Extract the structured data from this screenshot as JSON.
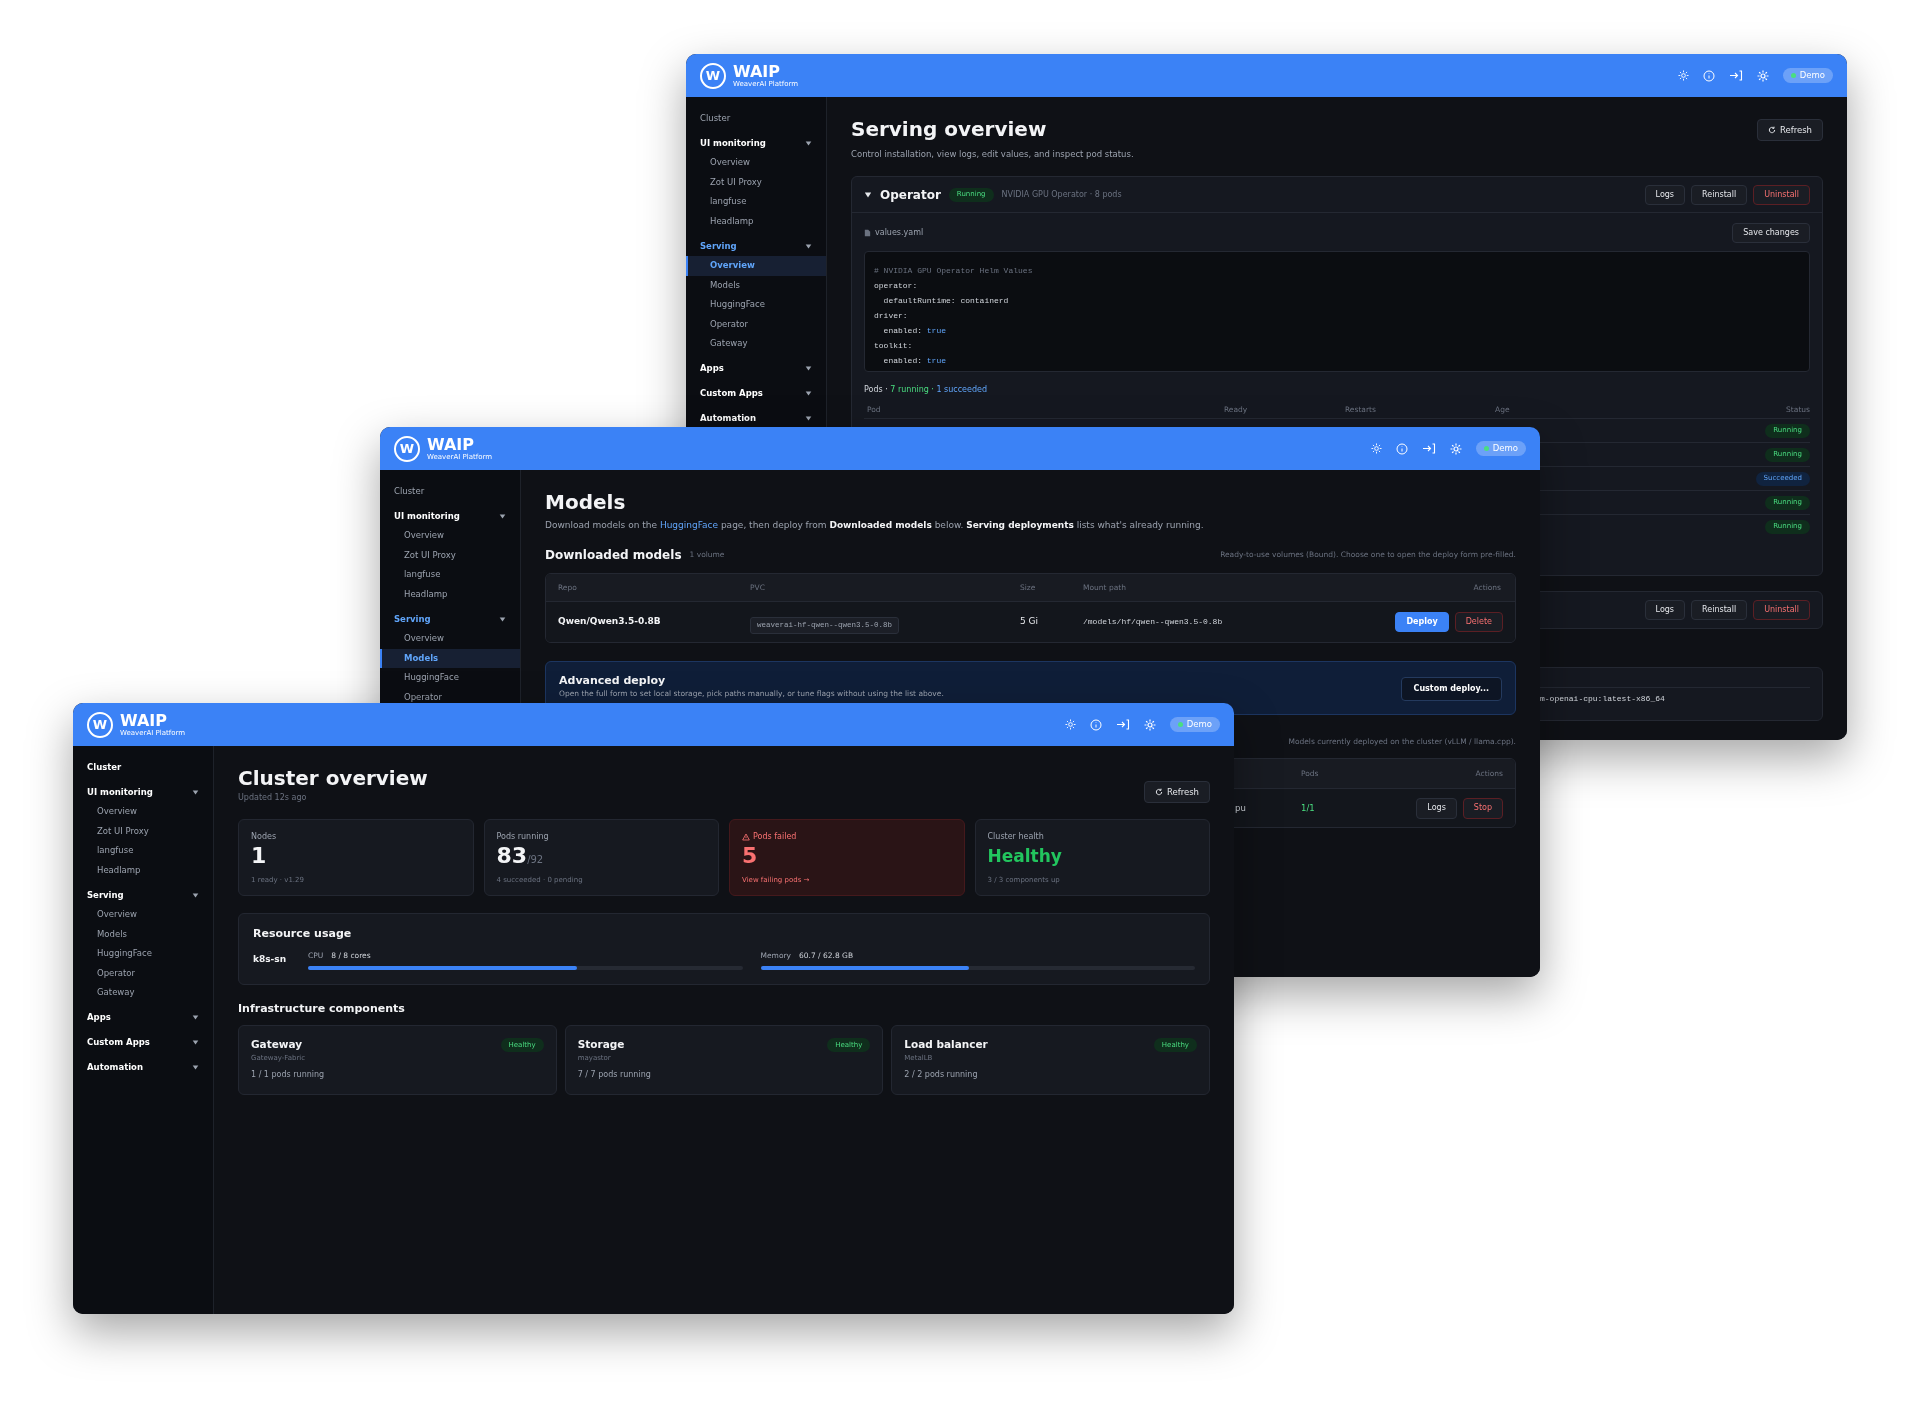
{
  "windows": [
    {
      "kind": "serving_overview",
      "header": {
        "logo_letter": "W",
        "title": "WAIP",
        "subtitle": "WeaverAI Platform",
        "environment": "Demo"
      },
      "sidebar": [
        {
          "kind": "link",
          "label": "Cluster",
          "selected": false
        },
        {
          "kind": "group",
          "label": "UI monitoring",
          "children": [
            {
              "label": "Overview",
              "selected": false
            },
            {
              "label": "Zot UI Proxy",
              "selected": false
            },
            {
              "label": "langfuse",
              "selected": false
            },
            {
              "label": "Headlamp",
              "selected": false
            }
          ]
        },
        {
          "kind": "group",
          "label": "Serving",
          "children": [
            {
              "label": "Overview",
              "selected": true
            },
            {
              "label": "Models",
              "selected": false
            },
            {
              "label": "HuggingFace",
              "selected": false
            },
            {
              "label": "Operator",
              "selected": false
            },
            {
              "label": "Gateway",
              "selected": false
            }
          ]
        },
        {
          "kind": "group",
          "label": "Apps"
        },
        {
          "kind": "group",
          "label": "Custom Apps"
        },
        {
          "kind": "group",
          "label": "Automation"
        }
      ],
      "page": {
        "title": "Serving overview",
        "description": "Control installation, view logs, edit values, and inspect pod status.",
        "refresh": "Refresh",
        "components": [
          {
            "kind": "expanded",
            "name": "Operator",
            "status": {
              "label": "Running",
              "kind": "running"
            },
            "meta": "NVIDIA GPU Operator · 8 pods",
            "actions": [
              {
                "label": "Logs",
                "kind": "default"
              },
              {
                "label": "Reinstall",
                "kind": "default"
              },
              {
                "label": "Uninstall",
                "kind": "danger"
              }
            ],
            "file": "values.yaml",
            "save": "Save changes",
            "code": [
              [
                {
                  "text": "# NVIDIA GPU Operator Helm Values",
                  "kind": "comment"
                }
              ],
              [
                {
                  "text": "operator:",
                  "kind": "plain"
                }
              ],
              [
                {
                  "text": "  defaultRuntime: containerd",
                  "kind": "plain"
                }
              ],
              [
                {
                  "text": "driver:",
                  "kind": "plain"
                }
              ],
              [
                {
                  "text": "  enabled: ",
                  "kind": "plain"
                },
                {
                  "text": "true",
                  "kind": "bool"
                }
              ],
              [
                {
                  "text": "toolkit:",
                  "kind": "plain"
                }
              ],
              [
                {
                  "text": "  enabled: ",
                  "kind": "plain"
                },
                {
                  "text": "true",
                  "kind": "bool"
                }
              ]
            ],
            "pods_summary": [
              {
                "text": "Pods · ",
                "kind": "plain"
              },
              {
                "text": "7 running · ",
                "kind": "running"
              },
              {
                "text": "1 succeeded",
                "kind": "succeeded"
              }
            ],
            "columns": [
              "Pod",
              "Ready",
              "Restarts",
              "Age",
              "Status"
            ],
            "rows": [
              {
                "status": "Running",
                "kind": "running"
              },
              {
                "status": "Running",
                "kind": "running"
              },
              {
                "status": "Succeeded",
                "kind": "succeeded"
              },
              {
                "status": "Running",
                "kind": "running"
              },
              {
                "status": "Running",
                "kind": "running"
              }
            ]
          },
          {
            "kind": "collapsed",
            "actions": [
              {
                "label": "Logs",
                "kind": "default"
              },
              {
                "label": "Reinstall",
                "kind": "default"
              },
              {
                "label": "Uninstall",
                "kind": "danger"
              }
            ]
          },
          {
            "kind": "image",
            "code": "m-openai-cpu:latest-x86_64"
          }
        ]
      }
    },
    {
      "kind": "models",
      "header": {
        "logo_letter": "W",
        "title": "WAIP",
        "subtitle": "WeaverAI Platform",
        "environment": "Demo"
      },
      "sidebar": [
        {
          "kind": "link",
          "label": "Cluster",
          "selected": false
        },
        {
          "kind": "group",
          "label": "UI monitoring",
          "children": [
            {
              "label": "Overview",
              "selected": false
            },
            {
              "label": "Zot UI Proxy",
              "selected": false
            },
            {
              "label": "langfuse",
              "selected": false
            },
            {
              "label": "Headlamp",
              "selected": false
            }
          ]
        },
        {
          "kind": "group",
          "label": "Serving",
          "children": [
            {
              "label": "Overview",
              "selected": false
            },
            {
              "label": "Models",
              "selected": true
            },
            {
              "label": "HuggingFace",
              "selected": false
            },
            {
              "label": "Operator",
              "selected": false
            }
          ]
        }
      ],
      "page": {
        "title": "Models",
        "description": {
          "before": "Download models on the ",
          "link": "HuggingFace",
          "after": " page, then deploy from **Downloaded models** below. **Serving deployments** lists what's already running."
        },
        "downloaded": {
          "title": "Downloaded models",
          "count": "1 volume",
          "hint": "Ready-to-use volumes (Bound). Choose one to open the deploy form pre-filled.",
          "columns": [
            "Repo",
            "PVC",
            "Size",
            "Mount path",
            "Actions"
          ],
          "rows": [
            {
              "repo": "Qwen/Qwen3.5-0.8B",
              "pvc": "weaverai-hf-qwen--qwen3.5-0.8b",
              "size": "5 Gi",
              "mount": "/models/hf/qwen--qwen3.5-0.8b",
              "actions": [
                {
                  "label": "Deploy",
                  "kind": "primary"
                },
                {
                  "label": "Delete",
                  "kind": "danger"
                }
              ]
            }
          ]
        },
        "advanced": {
          "title": "Advanced deploy",
          "text": "Open the full form to set local storage, pick paths manually, or tune flags without using the list above.",
          "button": "Custom deploy..."
        },
        "deployments": {
          "hint": "Models currently deployed on the cluster (vLLM / llama.cpp).",
          "columns": [
            "Pods",
            "Actions"
          ],
          "rows": [
            {
              "name": "pu",
              "pods": "1/1",
              "actions": [
                {
                  "label": "Logs",
                  "kind": "default"
                },
                {
                  "label": "Stop",
                  "kind": "danger"
                }
              ]
            }
          ]
        }
      }
    },
    {
      "kind": "cluster_overview",
      "header": {
        "logo_letter": "W",
        "title": "WAIP",
        "subtitle": "WeaverAI Platform",
        "environment": "Demo"
      },
      "sidebar": [
        {
          "kind": "link",
          "label": "Cluster",
          "selected": true
        },
        {
          "kind": "group",
          "label": "UI monitoring",
          "children": [
            {
              "label": "Overview",
              "selected": false
            },
            {
              "label": "Zot UI Proxy",
              "selected": false
            },
            {
              "label": "langfuse",
              "selected": false
            },
            {
              "label": "Headlamp",
              "selected": false
            }
          ]
        },
        {
          "kind": "group",
          "label": "Serving",
          "children": [
            {
              "label": "Overview",
              "selected": false
            },
            {
              "label": "Models",
              "selected": false
            },
            {
              "label": "HuggingFace",
              "selected": false
            },
            {
              "label": "Operator",
              "selected": false
            },
            {
              "label": "Gateway",
              "selected": false
            }
          ]
        },
        {
          "kind": "group",
          "label": "Apps"
        },
        {
          "kind": "group",
          "label": "Custom Apps"
        },
        {
          "kind": "group",
          "label": "Automation"
        }
      ],
      "page": {
        "title": "Cluster overview",
        "updated": "Updated 12s ago",
        "refresh": "Refresh",
        "stats": [
          {
            "kind": "plain",
            "label": "Nodes",
            "value": "1",
            "sub": "1 ready · v1.29"
          },
          {
            "kind": "plain",
            "label": "Pods running",
            "value": "83",
            "total": "/92",
            "sub": "4 succeeded · 0 pending"
          },
          {
            "kind": "danger",
            "label": "Pods failed",
            "value": "5",
            "link": "View failing pods →"
          },
          {
            "kind": "health",
            "label": "Cluster health",
            "value": "Healthy",
            "sub": "3 / 3 components up"
          }
        ],
        "resources": {
          "title": "Resource usage",
          "nodes": [
            {
              "name": "k8s-sn",
              "meters": [
                {
                  "label": "CPU",
                  "reading": "8 / 8 cores",
                  "level": 0.62
                },
                {
                  "label": "Memory",
                  "reading": "60.7 / 62.8 GB",
                  "level": 0.48
                }
              ]
            }
          ]
        },
        "infra": {
          "title": "Infrastructure components",
          "items": [
            {
              "name": "Gateway",
              "detail": "Gateway-Fabric",
              "pods": "1 / 1 pods running",
              "status": "Healthy",
              "kind": "healthy"
            },
            {
              "name": "Storage",
              "detail": "mayastor",
              "pods": "7 / 7 pods running",
              "status": "Healthy",
              "kind": "healthy"
            },
            {
              "name": "Load balancer",
              "detail": "MetalLB",
              "pods": "2 / 2 pods running",
              "status": "Healthy",
              "kind": "healthy"
            }
          ]
        }
      }
    }
  ]
}
